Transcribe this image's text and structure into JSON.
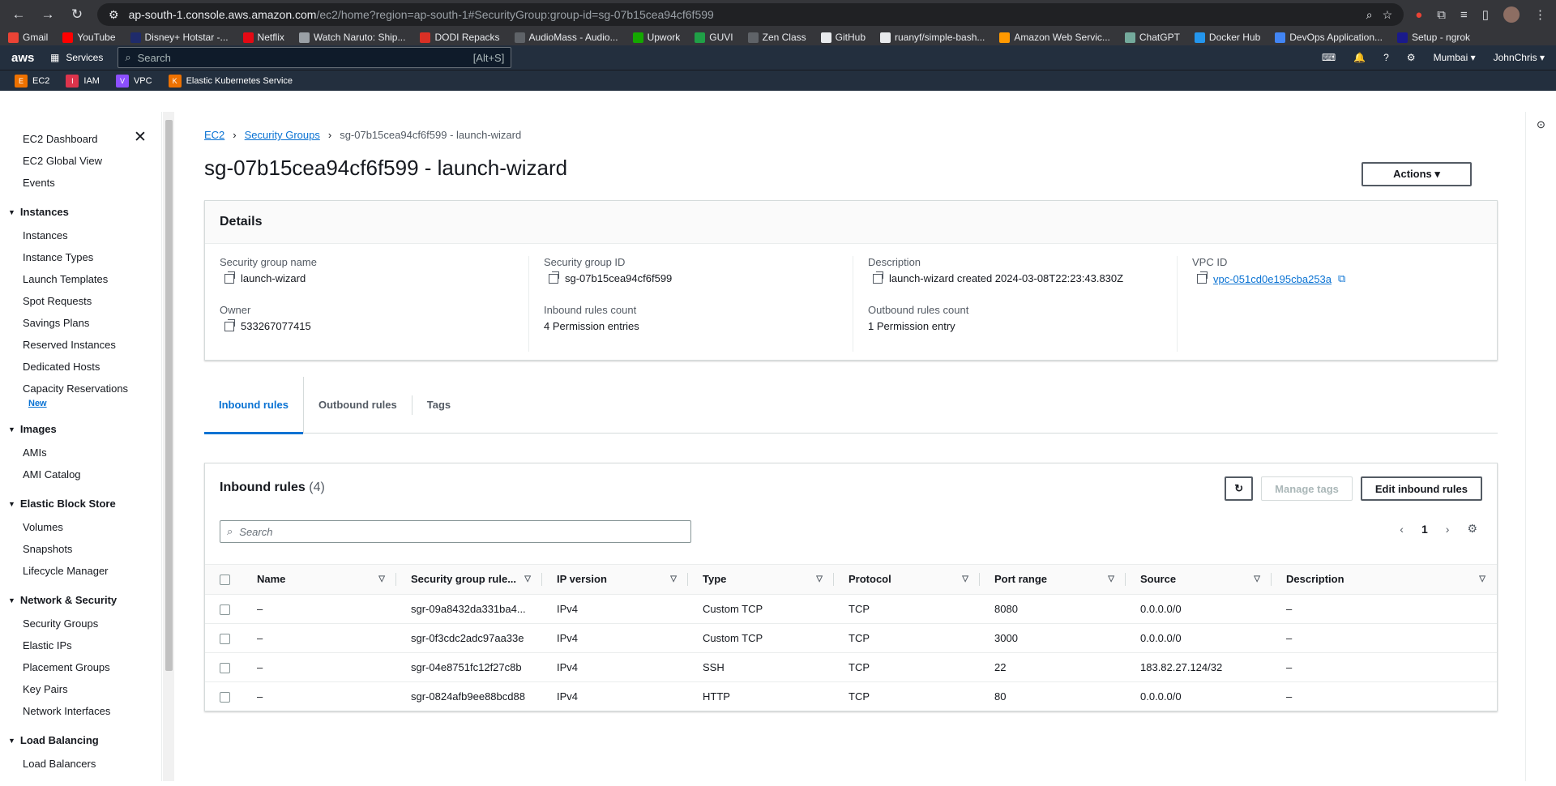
{
  "browser": {
    "url_host": "ap-south-1.console.aws.amazon.com",
    "url_path": "/ec2/home?region=ap-south-1#SecurityGroup:group-id=sg-07b15cea94cf6f599",
    "bookmarks": [
      {
        "label": "Gmail",
        "color": "#ea4335"
      },
      {
        "label": "YouTube",
        "color": "#ff0000"
      },
      {
        "label": "Disney+ Hotstar -...",
        "color": "#1f2b6b"
      },
      {
        "label": "Netflix",
        "color": "#e50914"
      },
      {
        "label": "Watch Naruto: Ship...",
        "color": "#9aa0a6"
      },
      {
        "label": "DODI Repacks",
        "color": "#d93025"
      },
      {
        "label": "AudioMass - Audio...",
        "color": "#5f6368"
      },
      {
        "label": "Upwork",
        "color": "#14a800"
      },
      {
        "label": "GUVI",
        "color": "#20a047"
      },
      {
        "label": "Zen Class",
        "color": "#5f6368"
      },
      {
        "label": "GitHub",
        "color": "#e8eaed"
      },
      {
        "label": "ruanyf/simple-bash...",
        "color": "#e8eaed"
      },
      {
        "label": "Amazon Web Servic...",
        "color": "#ff9900"
      },
      {
        "label": "ChatGPT",
        "color": "#74aa9c"
      },
      {
        "label": "Docker Hub",
        "color": "#2496ed"
      },
      {
        "label": "DevOps Application...",
        "color": "#4285f4"
      },
      {
        "label": "Setup - ngrok",
        "color": "#1a1a8c"
      }
    ]
  },
  "aws": {
    "logo": "aws",
    "services": "Services",
    "search_placeholder": "Search",
    "search_shortcut": "[Alt+S]",
    "region": "Mumbai",
    "user": "JohnChris",
    "favorites": [
      {
        "label": "EC2",
        "color": "#ed7100",
        "icon": "E"
      },
      {
        "label": "IAM",
        "color": "#dd344c",
        "icon": "I"
      },
      {
        "label": "VPC",
        "color": "#8c4fff",
        "icon": "V"
      },
      {
        "label": "Elastic Kubernetes Service",
        "color": "#ed7100",
        "icon": "K"
      }
    ]
  },
  "sidebar": {
    "top": [
      "EC2 Dashboard",
      "EC2 Global View",
      "Events"
    ],
    "sections": [
      {
        "title": "Instances",
        "items": [
          "Instances",
          "Instance Types",
          "Launch Templates",
          "Spot Requests",
          "Savings Plans",
          "Reserved Instances",
          "Dedicated Hosts",
          "Capacity Reservations"
        ],
        "badge": "New"
      },
      {
        "title": "Images",
        "items": [
          "AMIs",
          "AMI Catalog"
        ]
      },
      {
        "title": "Elastic Block Store",
        "items": [
          "Volumes",
          "Snapshots",
          "Lifecycle Manager"
        ]
      },
      {
        "title": "Network & Security",
        "items": [
          "Security Groups",
          "Elastic IPs",
          "Placement Groups",
          "Key Pairs",
          "Network Interfaces"
        ]
      },
      {
        "title": "Load Balancing",
        "items": [
          "Load Balancers"
        ]
      }
    ]
  },
  "breadcrumb": {
    "root": "EC2",
    "parent": "Security Groups",
    "current": "sg-07b15cea94cf6f599 - launch-wizard"
  },
  "page_title": "sg-07b15cea94cf6f599 - launch-wizard",
  "actions_label": "Actions",
  "details": {
    "title": "Details",
    "sg_name_label": "Security group name",
    "sg_name": "launch-wizard",
    "sg_id_label": "Security group ID",
    "sg_id": "sg-07b15cea94cf6f599",
    "desc_label": "Description",
    "desc": "launch-wizard created 2024-03-08T22:23:43.830Z",
    "vpc_label": "VPC ID",
    "vpc": "vpc-051cd0e195cba253a",
    "owner_label": "Owner",
    "owner": "533267077415",
    "inbound_label": "Inbound rules count",
    "inbound": "4 Permission entries",
    "outbound_label": "Outbound rules count",
    "outbound": "1 Permission entry"
  },
  "tabs": [
    "Inbound rules",
    "Outbound rules",
    "Tags"
  ],
  "rules": {
    "title": "Inbound rules",
    "count": "(4)",
    "manage_tags": "Manage tags",
    "edit": "Edit inbound rules",
    "search_placeholder": "Search",
    "page": "1",
    "columns": [
      "Name",
      "Security group rule...",
      "IP version",
      "Type",
      "Protocol",
      "Port range",
      "Source",
      "Description"
    ],
    "rows": [
      [
        "–",
        "sgr-09a8432da331ba4...",
        "IPv4",
        "Custom TCP",
        "TCP",
        "8080",
        "0.0.0.0/0",
        "–"
      ],
      [
        "–",
        "sgr-0f3cdc2adc97aa33e",
        "IPv4",
        "Custom TCP",
        "TCP",
        "3000",
        "0.0.0.0/0",
        "–"
      ],
      [
        "–",
        "sgr-04e8751fc12f27c8b",
        "IPv4",
        "SSH",
        "TCP",
        "22",
        "183.82.27.124/32",
        "–"
      ],
      [
        "–",
        "sgr-0824afb9ee88bcd88",
        "IPv4",
        "HTTP",
        "TCP",
        "80",
        "0.0.0.0/0",
        "–"
      ]
    ]
  }
}
